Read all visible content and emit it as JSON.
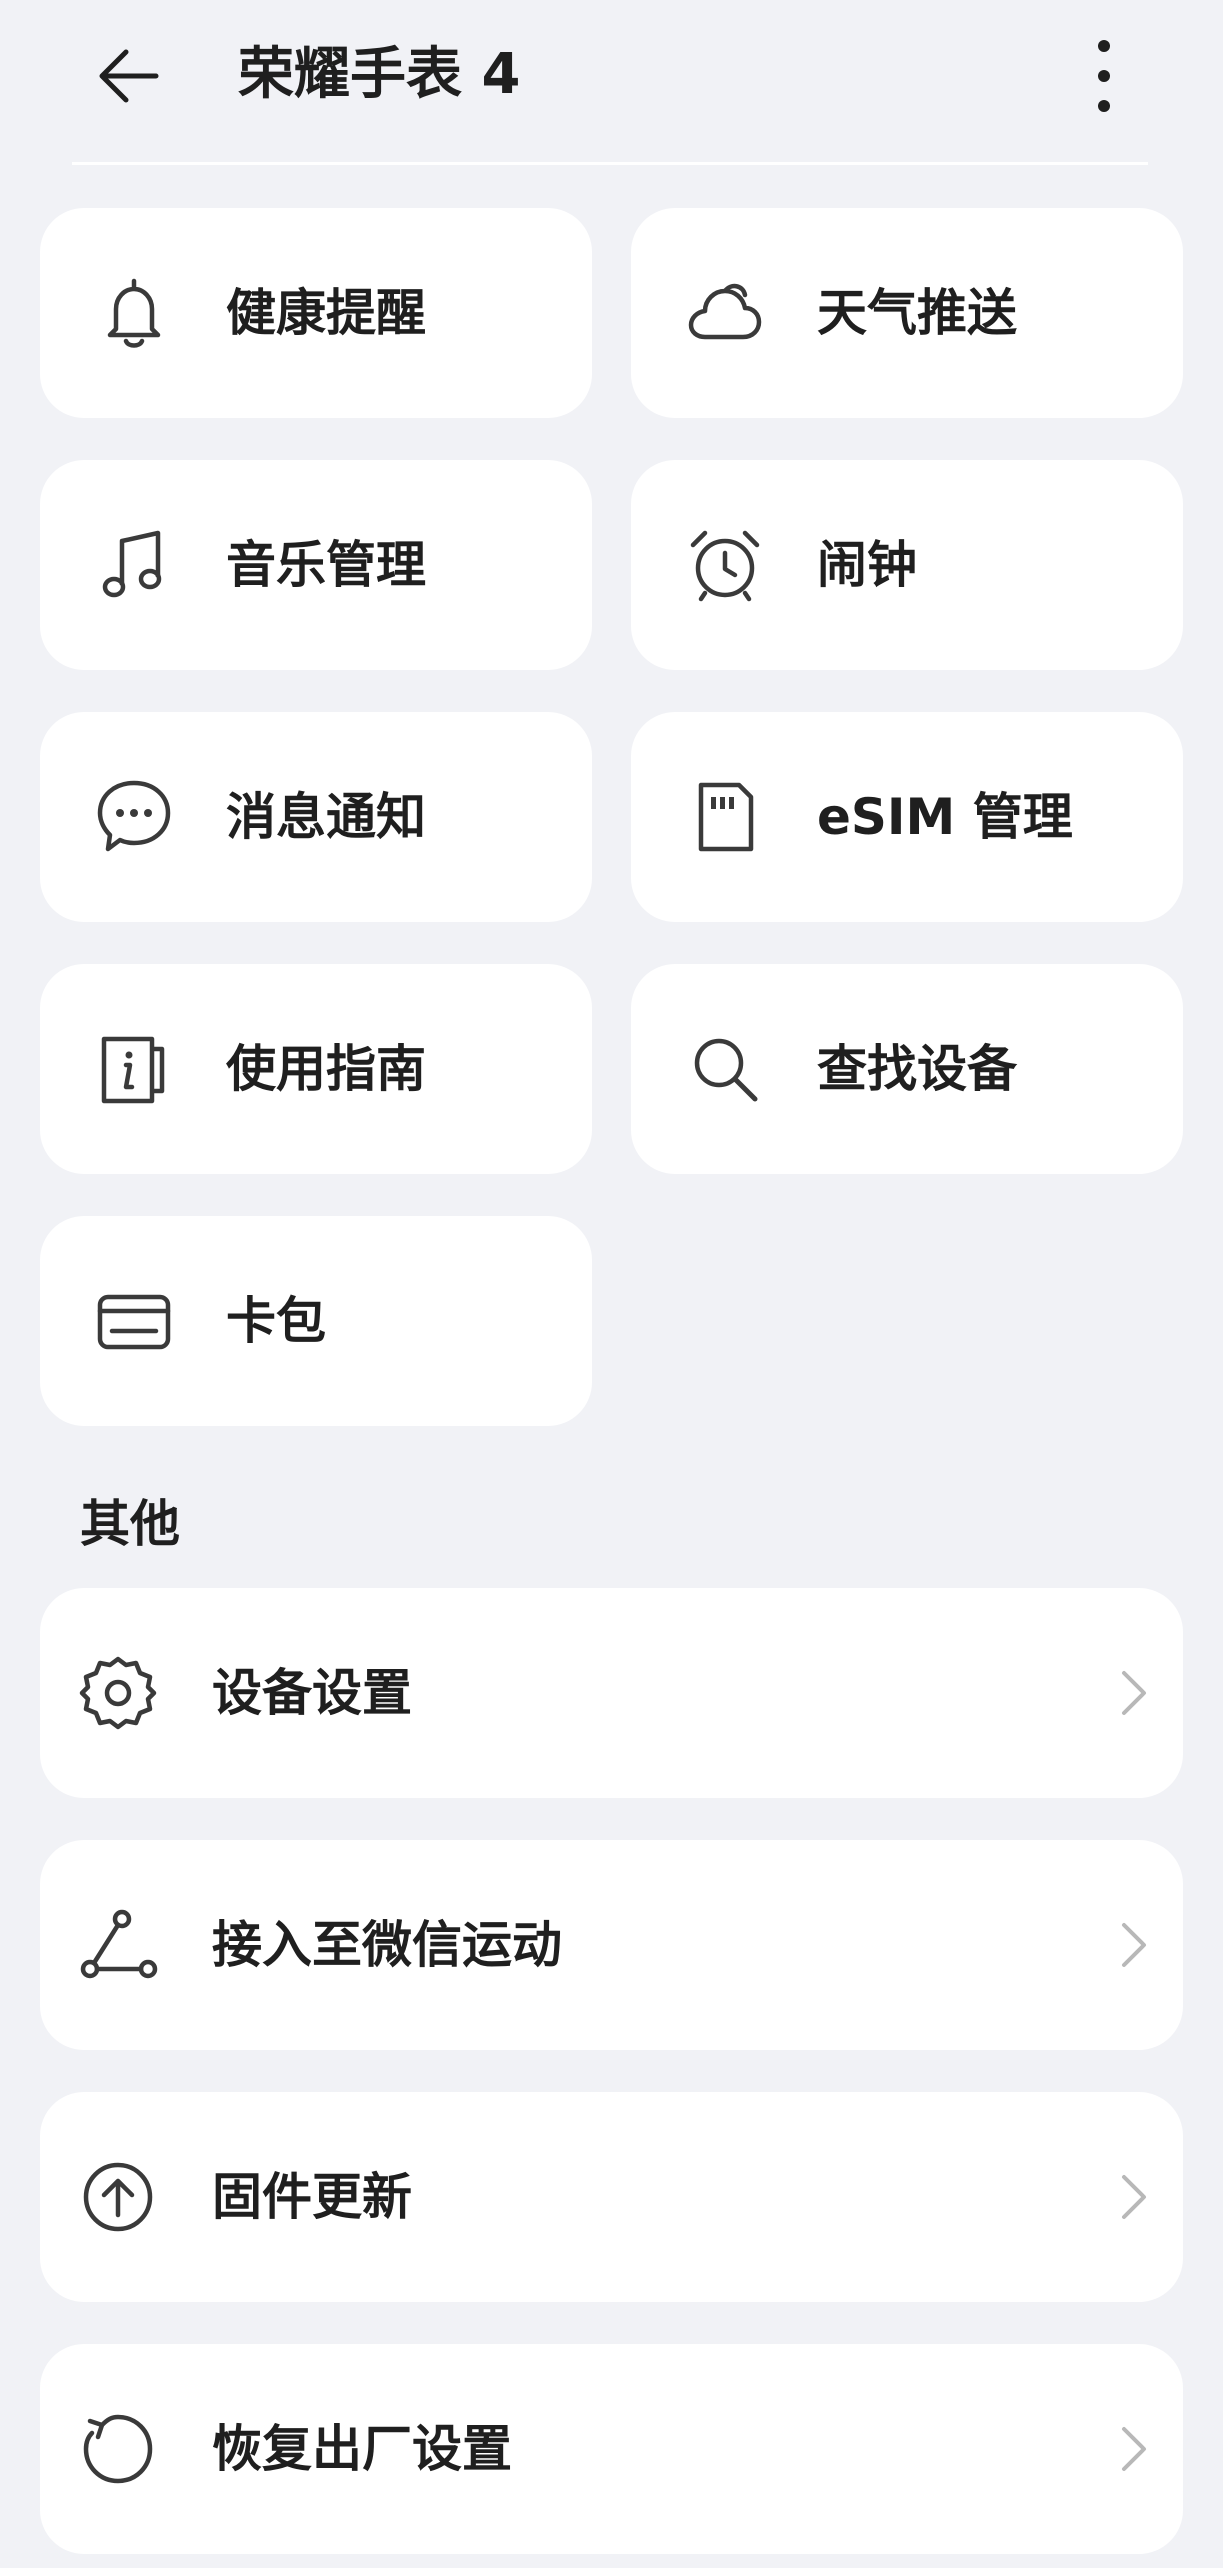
{
  "header": {
    "title": "荣耀手表 4",
    "back_icon": "arrow-left-icon",
    "more_icon": "more-vertical-icon"
  },
  "grid": [
    {
      "label": "健康提醒",
      "icon": "bell-icon"
    },
    {
      "label": "天气推送",
      "icon": "cloud-icon"
    },
    {
      "label": "音乐管理",
      "icon": "music-note-icon"
    },
    {
      "label": "闹钟",
      "icon": "alarm-clock-icon"
    },
    {
      "label": "消息通知",
      "icon": "chat-bubble-icon"
    },
    {
      "label": "eSIM 管理",
      "icon": "sim-card-icon"
    },
    {
      "label": "使用指南",
      "icon": "guide-book-icon"
    },
    {
      "label": "查找设备",
      "icon": "search-icon"
    },
    {
      "label": "卡包",
      "icon": "wallet-icon"
    }
  ],
  "other": {
    "title": "其他",
    "items": [
      {
        "label": "设备设置",
        "icon": "gear-icon"
      },
      {
        "label": "接入至微信运动",
        "icon": "share-nodes-icon"
      },
      {
        "label": "固件更新",
        "icon": "upload-circle-icon"
      },
      {
        "label": "恢复出厂设置",
        "icon": "refresh-icon"
      }
    ]
  },
  "colors": {
    "background": "#f1f2f6",
    "card": "#ffffff",
    "text": "#1f1f1f",
    "icon": "#3a3a3a",
    "chevron": "#b8b8b8"
  }
}
